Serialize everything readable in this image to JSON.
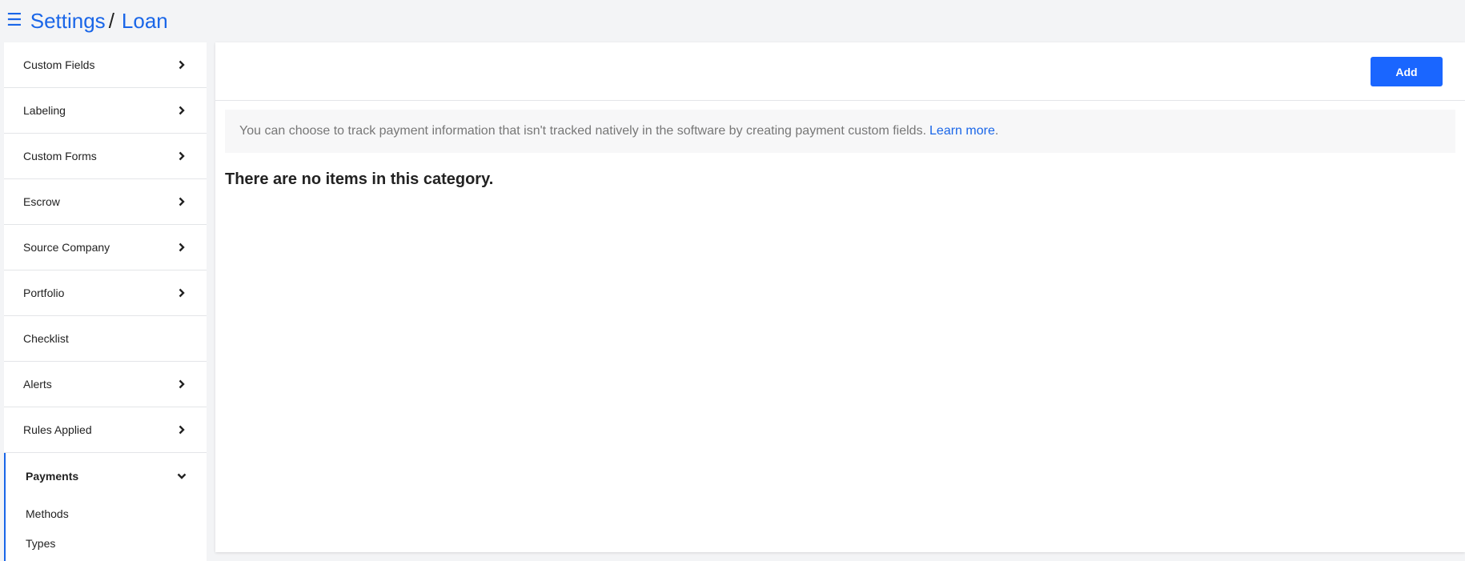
{
  "breadcrumb": {
    "menu_icon": "hamburger-icon",
    "root": "Settings",
    "separator": "/",
    "current": "Loan"
  },
  "sidebar": {
    "items": [
      {
        "label": "Custom Fields",
        "icon": "chevron-right-icon"
      },
      {
        "label": "Labeling",
        "icon": "chevron-right-icon"
      },
      {
        "label": "Custom Forms",
        "icon": "chevron-right-icon"
      },
      {
        "label": "Escrow",
        "icon": "chevron-right-icon"
      },
      {
        "label": "Source Company",
        "icon": "chevron-right-icon"
      },
      {
        "label": "Portfolio",
        "icon": "chevron-right-icon"
      },
      {
        "label": "Checklist"
      },
      {
        "label": "Alerts",
        "icon": "chevron-right-icon"
      },
      {
        "label": "Rules Applied",
        "icon": "chevron-right-icon"
      }
    ],
    "active_item": {
      "label": "Payments",
      "icon": "chevron-down-icon",
      "subitems": [
        {
          "label": "Methods"
        },
        {
          "label": "Types"
        }
      ]
    }
  },
  "main": {
    "add_label": "Add",
    "info_text": "You can choose to track payment information that isn't tracked natively in the software by creating payment custom fields.",
    "info_link": "Learn more",
    "info_suffix": ".",
    "empty_message": "There are no items in this category."
  },
  "colors": {
    "accent": "#1a66e8",
    "button": "#1a66ff",
    "background": "#f3f4f6"
  }
}
